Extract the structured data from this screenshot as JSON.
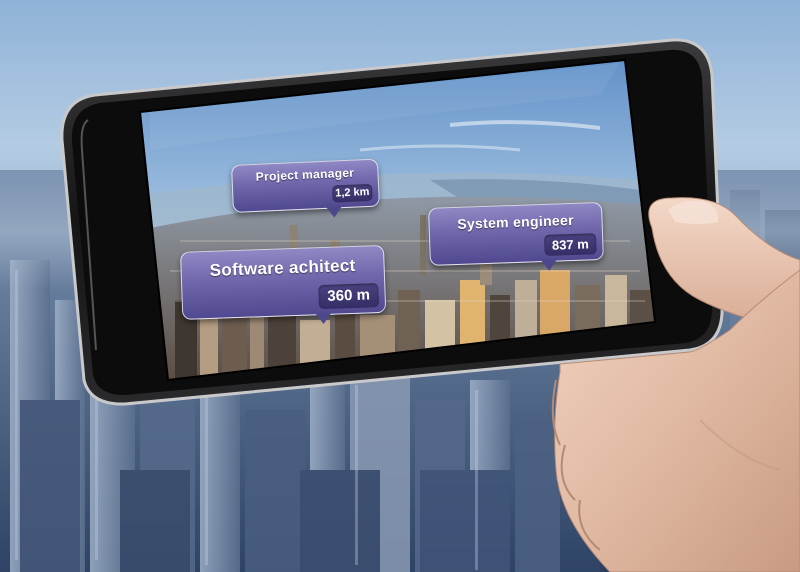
{
  "ar_tags": [
    {
      "title": "Project manager",
      "distance": "1,2 km"
    },
    {
      "title": "System engineer",
      "distance": "837 m"
    },
    {
      "title": "Software achitect",
      "distance": "360 m"
    }
  ],
  "colors": {
    "tag_fill": "#6f66ab",
    "tag_badge": "#342e66",
    "phone_body": "#111111",
    "sky": "#8fb2d8"
  }
}
